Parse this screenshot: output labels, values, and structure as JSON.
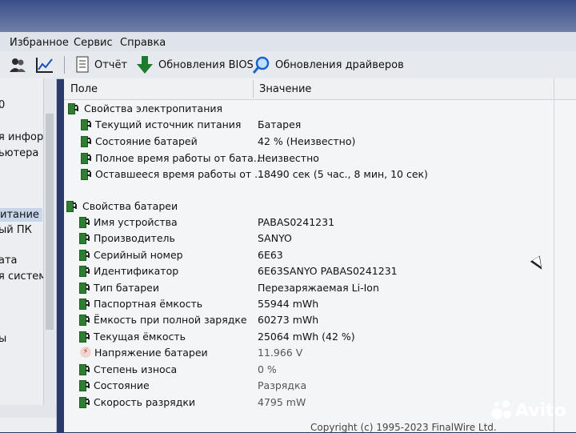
{
  "menu": {
    "items": [
      "Избранное",
      "Сервис",
      "Справка"
    ]
  },
  "toolbar": {
    "report_label": "Отчёт",
    "bios_label": "Обновления BIOS",
    "drivers_label": "Обновления драйверов"
  },
  "tree": {
    "items": [
      "0",
      "я инфор",
      "ьютера",
      "итание",
      "ый ПК",
      "ата",
      "я систем",
      "ы"
    ],
    "selected_index": 3
  },
  "table": {
    "col_field": "Поле",
    "col_value": "Значение"
  },
  "power": {
    "title": "Свойства электропитания",
    "rows": [
      {
        "label": "Текущий источник питания",
        "value": "Батарея"
      },
      {
        "label": "Состояние батарей",
        "value": "42 % (Неизвестно)"
      },
      {
        "label": "Полное время работы от бата...",
        "value": "Неизвестно"
      },
      {
        "label": "Оставшееся время работы от ...",
        "value": "18490 сек (5 час., 8 мин, 10 сек)"
      }
    ]
  },
  "battery": {
    "title": "Свойства батареи",
    "rows": [
      {
        "label": "Имя устройства",
        "value": "PABAS0241231"
      },
      {
        "label": "Производитель",
        "value": "SANYO"
      },
      {
        "label": "Серийный номер",
        "value": "6E63"
      },
      {
        "label": "Идентификатор",
        "value": "6E63SANYO PABAS0241231"
      },
      {
        "label": "Тип батареи",
        "value": "Перезаряжаемая Li-Ion"
      },
      {
        "label": "Паспортная ёмкость",
        "value": "55944 mWh"
      },
      {
        "label": "Ёмкость при полной зарядке",
        "value": "60273 mWh"
      },
      {
        "label": "Текущая ёмкость",
        "value": "25064 mWh  (42 %)"
      },
      {
        "label": "Напряжение батареи",
        "value": "11.966 V"
      },
      {
        "label": "Степень износа",
        "value": "0 %"
      },
      {
        "label": "Состояние",
        "value": "Разрядка"
      },
      {
        "label": "Скорость разрядки",
        "value": "4795 mW"
      }
    ]
  },
  "footer": {
    "copyright": "Copyright (c) 1995-2023 FinalWire Ltd."
  },
  "watermark": {
    "text": "Avito"
  }
}
